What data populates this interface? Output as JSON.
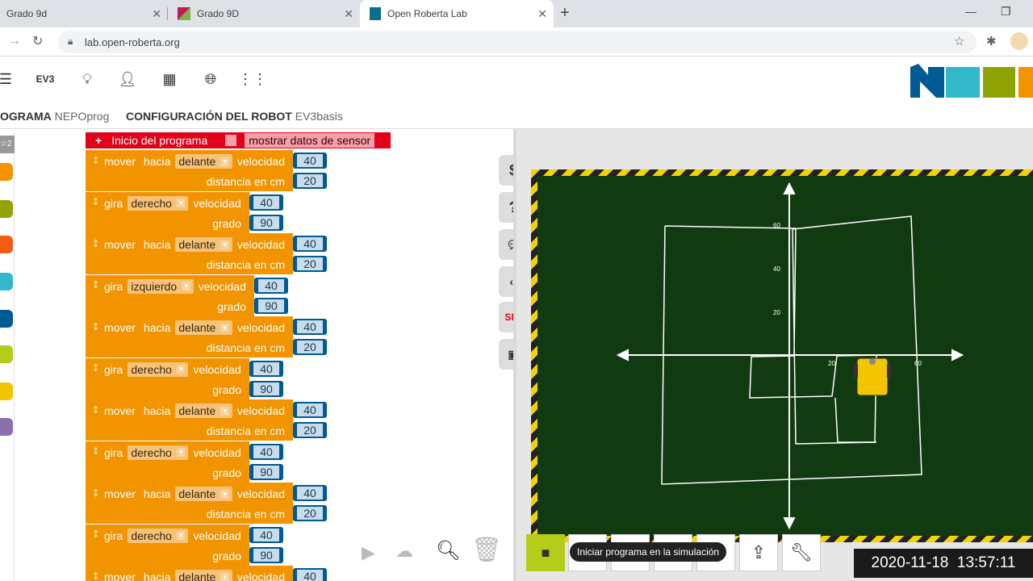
{
  "browser": {
    "tabs": [
      {
        "title": "Grado 9d"
      },
      {
        "title": "Grado 9D"
      },
      {
        "title": "Open Roberta Lab"
      }
    ],
    "new_tab": "+",
    "url": "lab.open-roberta.org"
  },
  "app": {
    "toolbar": {
      "robot_label": "EV3"
    },
    "program_tab": {
      "label": "OGRAMA",
      "name": "NEPOprog"
    },
    "config_tab": {
      "label": "CONFIGURACIÓN DEL ROBOT",
      "name": "EV3basis"
    },
    "toolbox_level": "☆2"
  },
  "program": {
    "start_block": {
      "label": "Inicio del programa",
      "sensor_label": "mostrar datos de sensor"
    },
    "blocks": [
      {
        "type": "move",
        "word1": "mover",
        "word2": "hacia",
        "dir": "delante",
        "speed_label": "velocidad",
        "speed": "40",
        "param_label": "distancia en cm",
        "param": "20"
      },
      {
        "type": "turn",
        "word1": "gira",
        "dir": "derecho",
        "speed_label": "velocidad",
        "speed": "40",
        "param_label": "grado",
        "param": "90"
      },
      {
        "type": "move",
        "word1": "mover",
        "word2": "hacia",
        "dir": "delante",
        "speed_label": "velocidad",
        "speed": "40",
        "param_label": "distancia en cm",
        "param": "20"
      },
      {
        "type": "turn",
        "word1": "gira",
        "dir": "izquierdo",
        "speed_label": "velocidad",
        "speed": "40",
        "param_label": "grado",
        "param": "90"
      },
      {
        "type": "move",
        "word1": "mover",
        "word2": "hacia",
        "dir": "delante",
        "speed_label": "velocidad",
        "speed": "40",
        "param_label": "distancia en cm",
        "param": "20"
      },
      {
        "type": "turn",
        "word1": "gira",
        "dir": "derecho",
        "speed_label": "velocidad",
        "speed": "40",
        "param_label": "grado",
        "param": "90"
      },
      {
        "type": "move",
        "word1": "mover",
        "word2": "hacia",
        "dir": "delante",
        "speed_label": "velocidad",
        "speed": "40",
        "param_label": "distancia en cm",
        "param": "20"
      },
      {
        "type": "turn",
        "word1": "gira",
        "dir": "derecho",
        "speed_label": "velocidad",
        "speed": "40",
        "param_label": "grado",
        "param": "90"
      },
      {
        "type": "move",
        "word1": "mover",
        "word2": "hacia",
        "dir": "delante",
        "speed_label": "velocidad",
        "speed": "40",
        "param_label": "distancia en cm",
        "param": "20"
      },
      {
        "type": "turn",
        "word1": "gira",
        "dir": "derecho",
        "speed_label": "velocidad",
        "speed": "40",
        "param_label": "grado",
        "param": "90"
      },
      {
        "type": "move",
        "word1": "mover",
        "word2": "hacia",
        "dir": "delante",
        "speed_label": "velocidad",
        "speed": "40"
      }
    ]
  },
  "side_panel": {
    "code_symbol": "$",
    "help_symbol": "?",
    "sim_label": "SIM"
  },
  "simulation": {
    "axis_labels": {
      "y60": "60",
      "y40": "40",
      "y20": "20",
      "x20": "20",
      "x60": "60"
    },
    "tooltip": "Iniciar programa en la simulación",
    "timestamp": "2020-11-18  13:57:11"
  }
}
